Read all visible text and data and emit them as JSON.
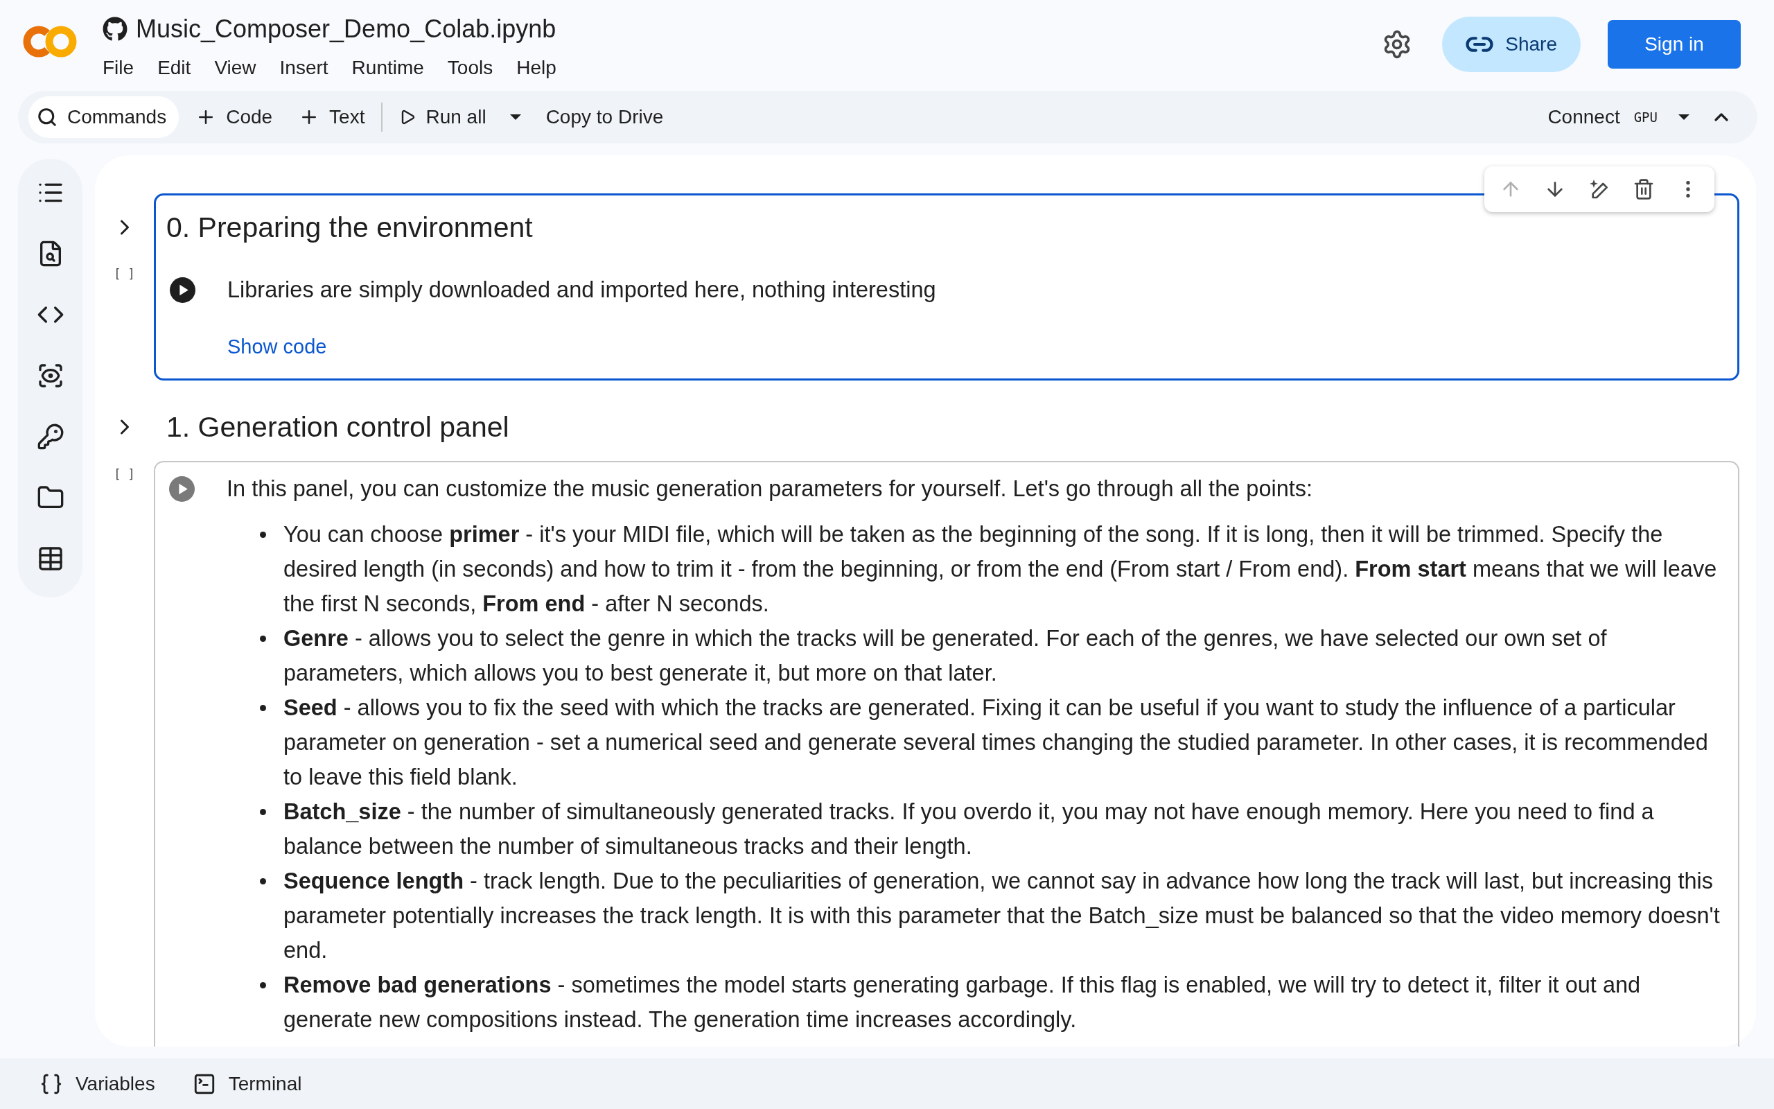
{
  "header": {
    "title": "Music_Composer_Demo_Colab.ipynb",
    "menu": [
      "File",
      "Edit",
      "View",
      "Insert",
      "Runtime",
      "Tools",
      "Help"
    ],
    "share_button": "Share",
    "sign_in_button": "Sign in"
  },
  "toolbar": {
    "items": [
      {
        "kind": "search",
        "label": "Commands"
      },
      {
        "kind": "add",
        "label": "Code"
      },
      {
        "kind": "add",
        "label": "Text"
      },
      {
        "kind": "run",
        "label": "Run all"
      },
      {
        "kind": "plain",
        "label": "Copy to Drive"
      }
    ],
    "connect": {
      "label": "Connect",
      "accelerator": "GPU"
    }
  },
  "cells": [
    {
      "selected": true,
      "title": "0. Preparing the environment",
      "execution_count": "[ ]",
      "description": "Libraries are simply downloaded and imported here, nothing interesting",
      "link": "Show code",
      "toolbar": [
        {
          "kind": "move_up",
          "disabled": true
        },
        {
          "kind": "move_down",
          "disabled": false
        },
        {
          "kind": "edit",
          "disabled": false
        },
        {
          "kind": "delete",
          "disabled": false
        },
        {
          "kind": "more",
          "disabled": false
        }
      ]
    },
    {
      "selected": false,
      "title": "1. Generation control panel",
      "execution_count": "[ ]",
      "description": "In this panel, you can customize the music generation parameters for yourself. Let's go through all the points:",
      "bullets": [
        "You can choose **primer** - it's your MIDI file, which will be taken as the beginning of the song. If it is long, then it will be trimmed. Specify the desired length (in seconds) and how to trim it - from the beginning, or from the end (From start / From end). **From start** means that we will leave the first N seconds, **From end** - after N seconds.",
        "**Genre** - allows you to select the genre in which the tracks will be generated. For each of the genres, we have selected our own set of parameters, which allows you to best generate it, but more on that later.",
        "**Seed** - allows you to fix the seed with which the tracks are generated. Fixing it can be useful if you want to study the influence of a particular parameter on generation - set a numerical seed and generate several times changing the studied parameter. In other cases, it is recommended to leave this field blank.",
        "**Batch_size** - the number of simultaneously generated tracks. If you overdo it, you may not have enough memory. Here you need to find a balance between the number of simultaneous tracks and their length.",
        "**Sequence length** - track length. Due to the peculiarities of generation, we cannot say in advance how long the track will last, but increasing this parameter potentially increases the track length. It is with this parameter that the Batch_size must be balanced so that the video memory doesn't end.",
        "**Remove bad generations** - sometimes the model starts generating garbage. If this flag is enabled, we will try to detect it, filter it out and generate new compositions instead. The generation time increases accordingly."
      ]
    }
  ],
  "bottom_bar": [
    {
      "kind": "variables",
      "label": "Variables"
    },
    {
      "kind": "terminal",
      "label": "Terminal"
    }
  ]
}
